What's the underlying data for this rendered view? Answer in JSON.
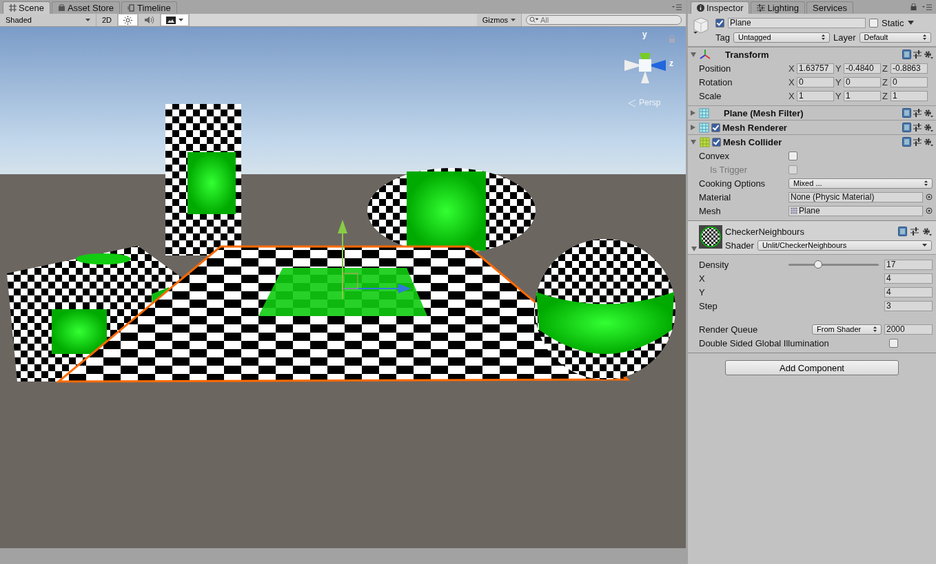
{
  "scene_panel": {
    "tabs": [
      {
        "label": "Scene",
        "selected": true
      },
      {
        "label": "Asset Store",
        "selected": false
      },
      {
        "label": "Timeline",
        "selected": false
      }
    ],
    "toolbar": {
      "draw_mode": "Shaded",
      "mode_2d": "2D",
      "mode_2d_on": false,
      "lighting_on": true,
      "audio_on": false,
      "effects_on": true,
      "gizmos": "Gizmos",
      "search_placeholder": "All"
    },
    "viewport": {
      "gizmo_y": "y",
      "gizmo_z": "z",
      "projection": "Persp"
    }
  },
  "inspector": {
    "tabs": [
      {
        "label": "Inspector",
        "selected": true
      },
      {
        "label": "Lighting",
        "selected": false
      },
      {
        "label": "Services",
        "selected": false
      }
    ],
    "object": {
      "active": true,
      "name": "Plane",
      "static": false,
      "static_label": "Static",
      "tag_label": "Tag",
      "tag": "Untagged",
      "layer_label": "Layer",
      "layer": "Default"
    },
    "components": [
      {
        "kind": "transform",
        "name": "Transform",
        "expanded": true,
        "rows": [
          {
            "label": "Position",
            "fields": [
              {
                "axis": "X",
                "value": "1.63757"
              },
              {
                "axis": "Y",
                "value": "-0.4840"
              },
              {
                "axis": "Z",
                "value": "-0.8863"
              }
            ]
          },
          {
            "label": "Rotation",
            "fields": [
              {
                "axis": "X",
                "value": "0"
              },
              {
                "axis": "Y",
                "value": "0"
              },
              {
                "axis": "Z",
                "value": "0"
              }
            ]
          },
          {
            "label": "Scale",
            "fields": [
              {
                "axis": "X",
                "value": "1"
              },
              {
                "axis": "Y",
                "value": "1"
              },
              {
                "axis": "Z",
                "value": "1"
              }
            ]
          }
        ]
      },
      {
        "kind": "filter",
        "name": "Plane (Mesh Filter)",
        "expanded": false
      },
      {
        "kind": "renderer",
        "name": "Mesh Renderer",
        "expanded": false,
        "enabled": true
      },
      {
        "kind": "collider",
        "name": "Mesh Collider",
        "expanded": true,
        "enabled": true,
        "fields": [
          {
            "kind": "checkbox",
            "label": "Convex",
            "checked": false,
            "disabled": false
          },
          {
            "kind": "checkbox",
            "label": "Is Trigger",
            "checked": false,
            "disabled": true
          },
          {
            "kind": "dropdown",
            "label": "Cooking Options",
            "value": "Mixed ..."
          },
          {
            "kind": "object",
            "label": "Material",
            "value": "None (Physic Material)"
          },
          {
            "kind": "mesh",
            "label": "Mesh",
            "value": "Plane"
          }
        ]
      }
    ],
    "material": {
      "name": "CheckerNeighbours",
      "shader_label": "Shader",
      "shader": "Unlit/CheckerNeighbours",
      "expanded": true,
      "properties": [
        {
          "kind": "slider",
          "label": "Density",
          "level": 0.32,
          "value": "17"
        },
        {
          "kind": "number",
          "label": "X",
          "value": "4"
        },
        {
          "kind": "number",
          "label": "Y",
          "value": "4"
        },
        {
          "kind": "number",
          "label": "Step",
          "value": "3"
        }
      ],
      "render_queue_label": "Render Queue",
      "render_queue_mode": "From Shader",
      "render_queue": "2000",
      "dsgi_label": "Double Sided Global Illumination",
      "dsgi": false
    },
    "add_component": "Add Component"
  }
}
